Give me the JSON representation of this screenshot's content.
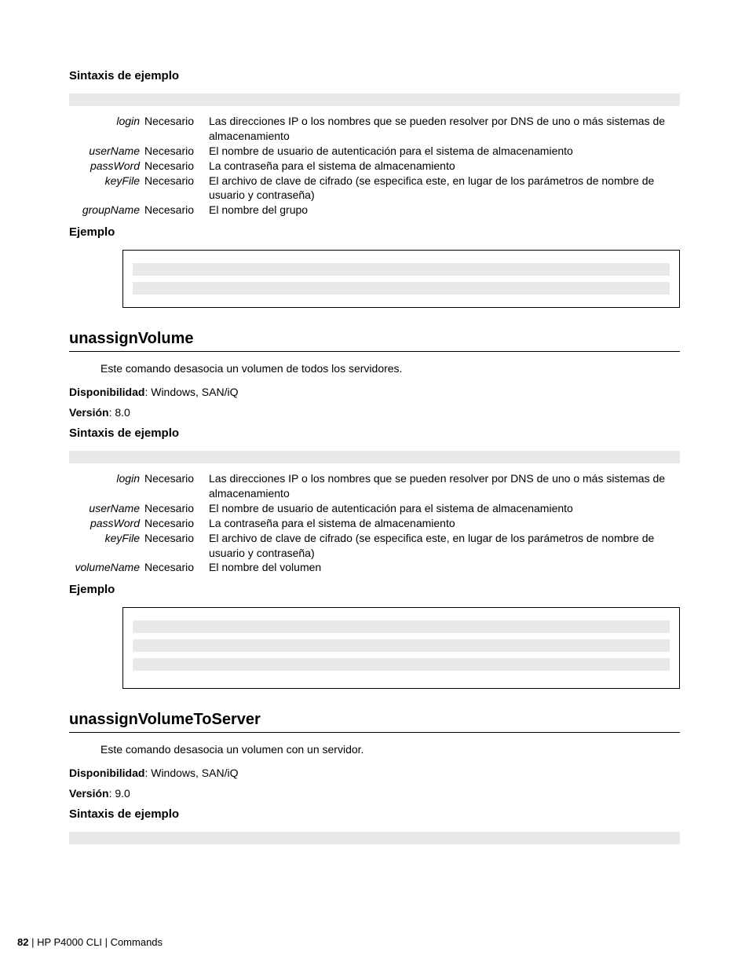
{
  "section1": {
    "syntax_heading": "Sintaxis de ejemplo",
    "params": [
      {
        "name": "login",
        "req": "Necesario",
        "desc": "Las direcciones IP o los nombres que se pueden resolver por DNS de uno o más sistemas de almacenamiento"
      },
      {
        "name": "userName",
        "req": "Necesario",
        "desc": "El nombre de usuario de autenticación para el sistema de almacenamiento"
      },
      {
        "name": "passWord",
        "req": "Necesario",
        "desc": "La contraseña para el sistema de almacenamiento"
      },
      {
        "name": "keyFile",
        "req": "Necesario",
        "desc": "El archivo de clave de cifrado (se especifica este, en lugar de los parámetros de nombre de usuario y contraseña)"
      },
      {
        "name": "groupName",
        "req": "Necesario",
        "desc": "El nombre del grupo"
      }
    ],
    "example_heading": "Ejemplo"
  },
  "section2": {
    "title": "unassignVolume",
    "intro": "Este comando desasocia un volumen de todos los servidores.",
    "avail_label": "Disponibilidad",
    "avail_value": ": Windows, SAN/iQ",
    "version_label": "Versión",
    "version_value": ": 8.0",
    "syntax_heading": "Sintaxis de ejemplo",
    "params": [
      {
        "name": "login",
        "req": "Necesario",
        "desc": "Las direcciones IP o los nombres que se pueden resolver por DNS de uno o más sistemas de almacenamiento"
      },
      {
        "name": "userName",
        "req": "Necesario",
        "desc": "El nombre de usuario de autenticación para el sistema de almacenamiento"
      },
      {
        "name": "passWord",
        "req": "Necesario",
        "desc": "La contraseña para el sistema de almacenamiento"
      },
      {
        "name": "keyFile",
        "req": "Necesario",
        "desc": "El archivo de clave de cifrado (se especifica este, en lugar de los parámetros de nombre de usuario y contraseña)"
      },
      {
        "name": "volumeName",
        "req": "Necesario",
        "desc": "El nombre del volumen"
      }
    ],
    "example_heading": "Ejemplo"
  },
  "section3": {
    "title": "unassignVolumeToServer",
    "intro": "Este comando desasocia un volumen con un servidor.",
    "avail_label": "Disponibilidad",
    "avail_value": ": Windows, SAN/iQ",
    "version_label": "Versión",
    "version_value": ": 9.0",
    "syntax_heading": "Sintaxis de ejemplo"
  },
  "footer": {
    "page": "82",
    "sep": " | ",
    "crumb1": "HP P4000 CLI",
    "crumb2": "Commands"
  }
}
